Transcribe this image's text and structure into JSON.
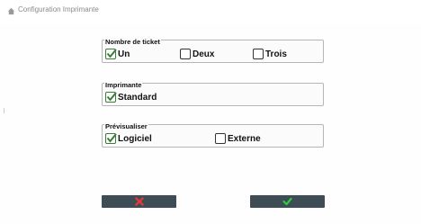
{
  "window": {
    "title": "Configuration Imprimante"
  },
  "groups": {
    "tickets": {
      "title": "Nombre de ticket",
      "options": [
        {
          "label": "Un",
          "checked": true
        },
        {
          "label": "Deux",
          "checked": false
        },
        {
          "label": "Trois",
          "checked": false
        }
      ]
    },
    "printer": {
      "title": "Imprimante",
      "options": [
        {
          "label": "Standard",
          "checked": true
        }
      ]
    },
    "preview": {
      "title": "Prévisualiser",
      "options": [
        {
          "label": "Logiciel",
          "checked": true
        },
        {
          "label": "Externe",
          "checked": false
        }
      ]
    }
  },
  "buttons": {
    "cancel": {
      "icon": "close-icon",
      "color": "#e03a3a"
    },
    "confirm": {
      "icon": "check-icon",
      "color": "#2ecc40"
    }
  },
  "colors": {
    "button_bg": "#3e4d55",
    "check_green": "#3b7d3b"
  }
}
